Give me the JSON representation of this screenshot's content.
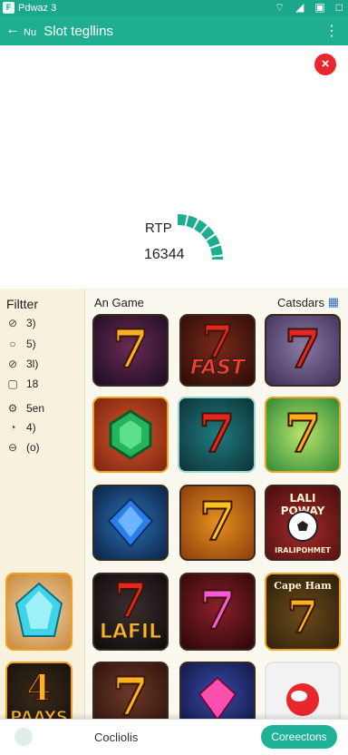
{
  "status_bar": {
    "badge": "F",
    "title": "Pdwaz 3",
    "icons": [
      "wifi-icon",
      "signal-icon",
      "square-icon",
      "box-icon"
    ]
  },
  "app_bar": {
    "title_prefix": "Nu",
    "title": "Slot tegllins",
    "more": "⋮",
    "back": "←"
  },
  "hero": {
    "close": "×",
    "rtp_label": "RTP",
    "rtp_value": "16344",
    "gauge_fraction": 0.33,
    "gauge_color": "#1cae8e"
  },
  "filter": {
    "title": "Filtter",
    "rows": [
      {
        "icon": "⊘",
        "label": "3)"
      },
      {
        "icon": "○",
        "label": "5)"
      },
      {
        "icon": "⊘",
        "label": "3l)"
      },
      {
        "icon": "▢",
        "label": "18"
      },
      {
        "icon": "⚙",
        "label": "5en"
      },
      {
        "icon": "◔",
        "label": "4)"
      },
      {
        "icon": "⊖",
        "label": "(o)"
      }
    ]
  },
  "main": {
    "header": "An Game",
    "categories_label": "Catsdars",
    "categories_icon": "calendar-icon"
  },
  "tiles": [
    {
      "name": "game-tile-seven-orange",
      "text": "7",
      "caption": ""
    },
    {
      "name": "game-tile-fast",
      "text": "7",
      "caption": "FAST"
    },
    {
      "name": "game-tile-seven-red",
      "text": "7",
      "caption": ""
    },
    {
      "name": "game-tile-green-gem",
      "text": "",
      "caption": ""
    },
    {
      "name": "game-tile-seven-teal",
      "text": "7",
      "caption": ""
    },
    {
      "name": "game-tile-seven-green",
      "text": "7",
      "caption": ""
    },
    {
      "name": "game-tile-blue-gem",
      "text": "",
      "caption": ""
    },
    {
      "name": "game-tile-seven-gold",
      "text": "7",
      "caption": ""
    },
    {
      "name": "game-tile-lali-poway",
      "text": "",
      "caption": "LALI POWAY",
      "sub": "IRALIPOHMET"
    },
    {
      "name": "game-tile-cyan-gem",
      "text": "",
      "caption": ""
    },
    {
      "name": "game-tile-lafil",
      "text": "7",
      "caption": "LAFIL"
    },
    {
      "name": "game-tile-seven-pink",
      "text": "7",
      "caption": ""
    },
    {
      "name": "game-tile-cape-ham",
      "text": "7",
      "caption": "Cape Ham"
    },
    {
      "name": "game-tile-paays",
      "text": "4",
      "caption": "PAAYS"
    },
    {
      "name": "game-tile-seven-bottom",
      "text": "7",
      "caption": ""
    },
    {
      "name": "game-tile-pink-gem",
      "text": "",
      "caption": ""
    },
    {
      "name": "game-tile-ball",
      "text": "",
      "caption": ""
    }
  ],
  "bottom_bar": {
    "center_label": "Cocliolis",
    "button_label": "Coreectons"
  }
}
